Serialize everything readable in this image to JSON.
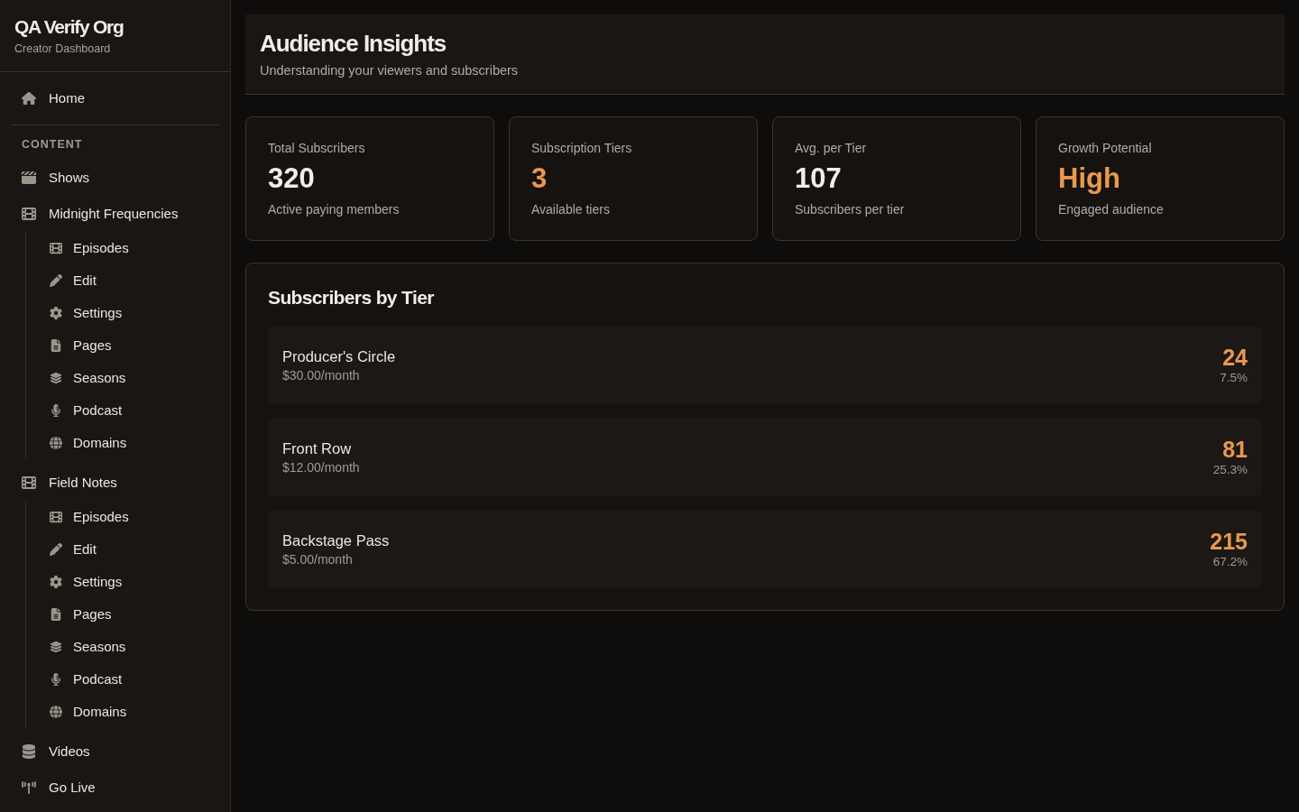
{
  "sidebar": {
    "org_name": "QA Verify Org",
    "subtitle": "Creator Dashboard",
    "top_links": [
      {
        "label": "Home"
      }
    ],
    "section_label": "CONTENT",
    "items": [
      {
        "kind": "link",
        "label": "Shows"
      },
      {
        "kind": "group",
        "label": "Midnight Frequencies",
        "children": [
          {
            "label": "Episodes"
          },
          {
            "label": "Edit"
          },
          {
            "label": "Settings"
          },
          {
            "label": "Pages"
          },
          {
            "label": "Seasons"
          },
          {
            "label": "Podcast"
          },
          {
            "label": "Domains"
          }
        ]
      },
      {
        "kind": "group",
        "label": "Field Notes",
        "children": [
          {
            "label": "Episodes"
          },
          {
            "label": "Edit"
          },
          {
            "label": "Settings"
          },
          {
            "label": "Pages"
          },
          {
            "label": "Seasons"
          },
          {
            "label": "Podcast"
          },
          {
            "label": "Domains"
          }
        ]
      },
      {
        "kind": "link",
        "label": "Videos"
      },
      {
        "kind": "link",
        "label": "Go Live"
      }
    ]
  },
  "header": {
    "title": "Audience Insights",
    "subtitle": "Understanding your viewers and subscribers"
  },
  "stats": [
    {
      "label": "Total Subscribers",
      "value": "320",
      "caption": "Active paying members",
      "accent": false
    },
    {
      "label": "Subscription Tiers",
      "value": "3",
      "caption": "Available tiers",
      "accent": true
    },
    {
      "label": "Avg. per Tier",
      "value": "107",
      "caption": "Subscribers per tier",
      "accent": false
    },
    {
      "label": "Growth Potential",
      "value": "High",
      "caption": "Engaged audience",
      "accent": true
    }
  ],
  "tier_panel": {
    "title": "Subscribers by Tier",
    "tiers": [
      {
        "name": "Producer's Circle",
        "price": "$30.00/month",
        "count": "24",
        "share": "7.5%"
      },
      {
        "name": "Front Row",
        "price": "$12.00/month",
        "count": "81",
        "share": "25.3%"
      },
      {
        "name": "Backstage Pass",
        "price": "$5.00/month",
        "count": "215",
        "share": "67.2%"
      }
    ]
  }
}
